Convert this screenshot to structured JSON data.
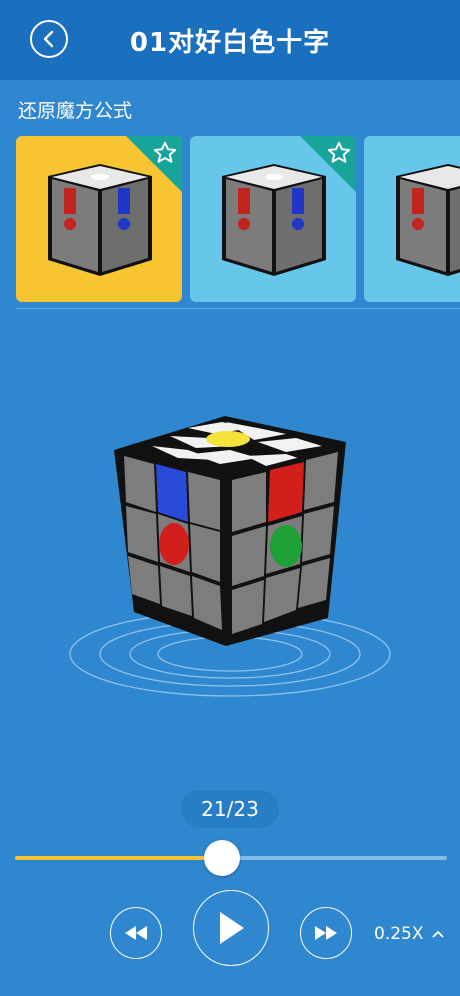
{
  "header": {
    "title": "01对好白色十字"
  },
  "section": {
    "title": "还原魔方公式"
  },
  "player": {
    "counter": "21/23",
    "progress": 0.48,
    "speed": "0.25X",
    "speed_caret": "^"
  },
  "colors": {
    "background": "#2f87cf",
    "header": "#1a6fbe",
    "accent": "#f7c531",
    "card_selected": "#f7c531",
    "card_default": "#67c7ea",
    "star_badge": "#17a59a"
  }
}
